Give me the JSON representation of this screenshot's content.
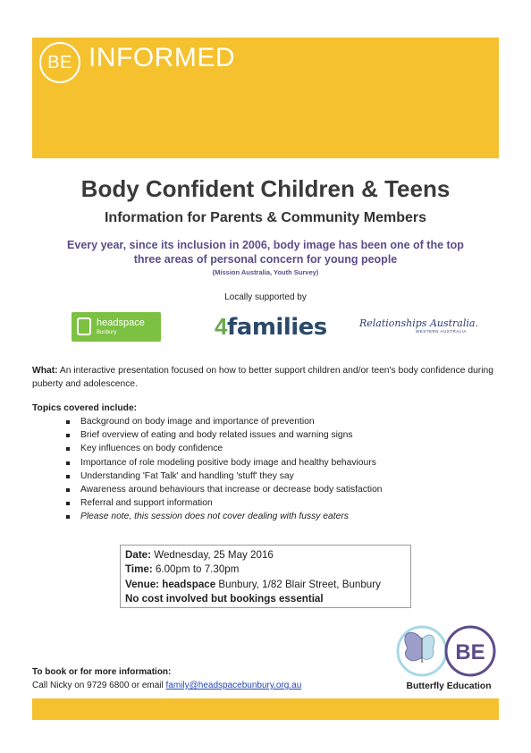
{
  "banner": {
    "logo_text": "BE",
    "title": "INFORMED"
  },
  "heading": {
    "title": "Body Confident Children & Teens",
    "subtitle": "Information for Parents & Community Members"
  },
  "intro": {
    "line1": "Every year, since its inclusion in 2006, body image has been one of the top",
    "line2": "three areas of personal concern for young people",
    "source": "(Mission Australia, Youth Survey)"
  },
  "supporters": {
    "label": "Locally supported by",
    "headspace_name": "headspace",
    "headspace_sub": "Bunbury",
    "families_four": "4",
    "families_rest": "families",
    "ra_name": "Relationships Australia.",
    "ra_sub": "WESTERN AUSTRALIA"
  },
  "what": {
    "label": "What:",
    "text": " An interactive presentation focused on how to better support children and/or teen's body confidence during puberty and adolescence."
  },
  "topics": {
    "heading": "Topics covered include:",
    "items": [
      "Background on body image and importance of prevention",
      "Brief overview of eating and body related issues and warning signs",
      "Key influences on body confidence",
      "Importance of role modeling positive body image and healthy behaviours",
      "Understanding 'Fat Talk' and handling 'stuff' they say",
      "Awareness around behaviours that increase or decrease body satisfaction",
      "Referral and support information",
      "Please note, this session does not cover dealing with fussy eaters"
    ]
  },
  "details": {
    "date_label": "Date:",
    "date_value": " Wednesday, 25 May 2016",
    "time_label": "Time:",
    "time_value": " 6.00pm to 7.30pm",
    "venue_label": "Venue:",
    "venue_bold": " headspace",
    "venue_value": " Bunbury, 1/82 Blair Street, Bunbury",
    "cost": "No cost involved but bookings essential"
  },
  "contact": {
    "heading": "To book or for more information:",
    "text": "Call Nicky on 9729 6800 or email ",
    "email": "family@headspacebunbury.org.au"
  },
  "butterfly": {
    "logo_text": "BE",
    "caption": "Butterfly Education"
  },
  "colors": {
    "banner": "#f5c12e",
    "purple": "#5b4d8a",
    "link": "#2245b8",
    "headspace_green": "#7dc142"
  }
}
